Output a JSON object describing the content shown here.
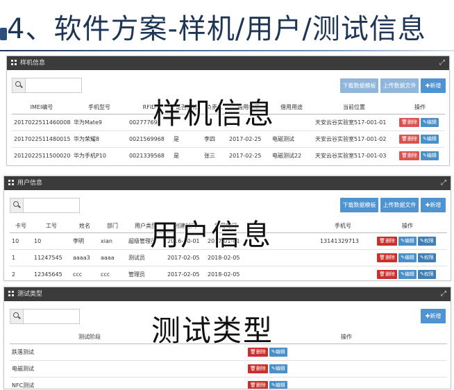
{
  "slide": {
    "title": "4、软件方案-样机/用户/测试信息"
  },
  "sample_panel": {
    "header": "样机信息",
    "overlay": "样机信息",
    "buttons": {
      "download": "下载数据模板",
      "upload": "上传数据文件",
      "add": "✚新增"
    },
    "columns": [
      "IMEI编号",
      "手机型号",
      "RFID",
      "是否维修",
      "负责人",
      "借用时间",
      "借用用途",
      "当前位置",
      "操作"
    ],
    "rows": [
      [
        "2017022511460008",
        "华为Mate9",
        "00277769",
        "",
        "",
        "",
        "",
        "天安云谷实验室517-001-01"
      ],
      [
        "2017022511480015",
        "华为荣耀8",
        "0021569968",
        "是",
        "李四",
        "2017-02-25",
        "电磁测试",
        "天安云谷实验室517-001-02"
      ],
      [
        "2012022511500020",
        "华为手机P10",
        "0021339568",
        "是",
        "张三",
        "2017-02-25",
        "电磁测试22",
        "天安云谷实验室517-001-03"
      ]
    ],
    "actions": {
      "delete": "删除",
      "edit": "编辑"
    }
  },
  "user_panel": {
    "header": "用户信息",
    "overlay": "用户信息",
    "buttons": {
      "download": "下载数据模板",
      "upload": "上传数据文件",
      "add": "✚新增"
    },
    "columns": [
      "卡号",
      "工号",
      "姓名",
      "部门",
      "用户类型",
      "创建时间",
      "禁用时间",
      "",
      "手机号",
      "操作"
    ],
    "rows": [
      [
        "10",
        "10",
        "李明",
        "xian",
        "超级管理员",
        "2016-10-01",
        "2017-01-01",
        "",
        "13141329713"
      ],
      [
        "1",
        "11247545",
        "aaaa3",
        "aaaa",
        "测试员",
        "2017-02-05",
        "2018-02-05",
        "",
        ""
      ],
      [
        "2",
        "12345645",
        "ccc",
        "ccc",
        "管理员",
        "2017-02-05",
        "2018-02-05",
        "",
        ""
      ]
    ],
    "actions": {
      "delete": "删除",
      "edit": "编辑",
      "perm": "权限"
    }
  },
  "test_panel": {
    "header": "测试类型",
    "overlay": "测试类型",
    "buttons": {
      "add": "✚新增"
    },
    "columns": [
      "测试阶段",
      "",
      "操作"
    ],
    "rows": [
      [
        "跌落测试"
      ],
      [
        "电磁测试"
      ],
      [
        "NFC测试"
      ]
    ],
    "actions": {
      "delete": "删除",
      "edit": "编辑"
    }
  }
}
